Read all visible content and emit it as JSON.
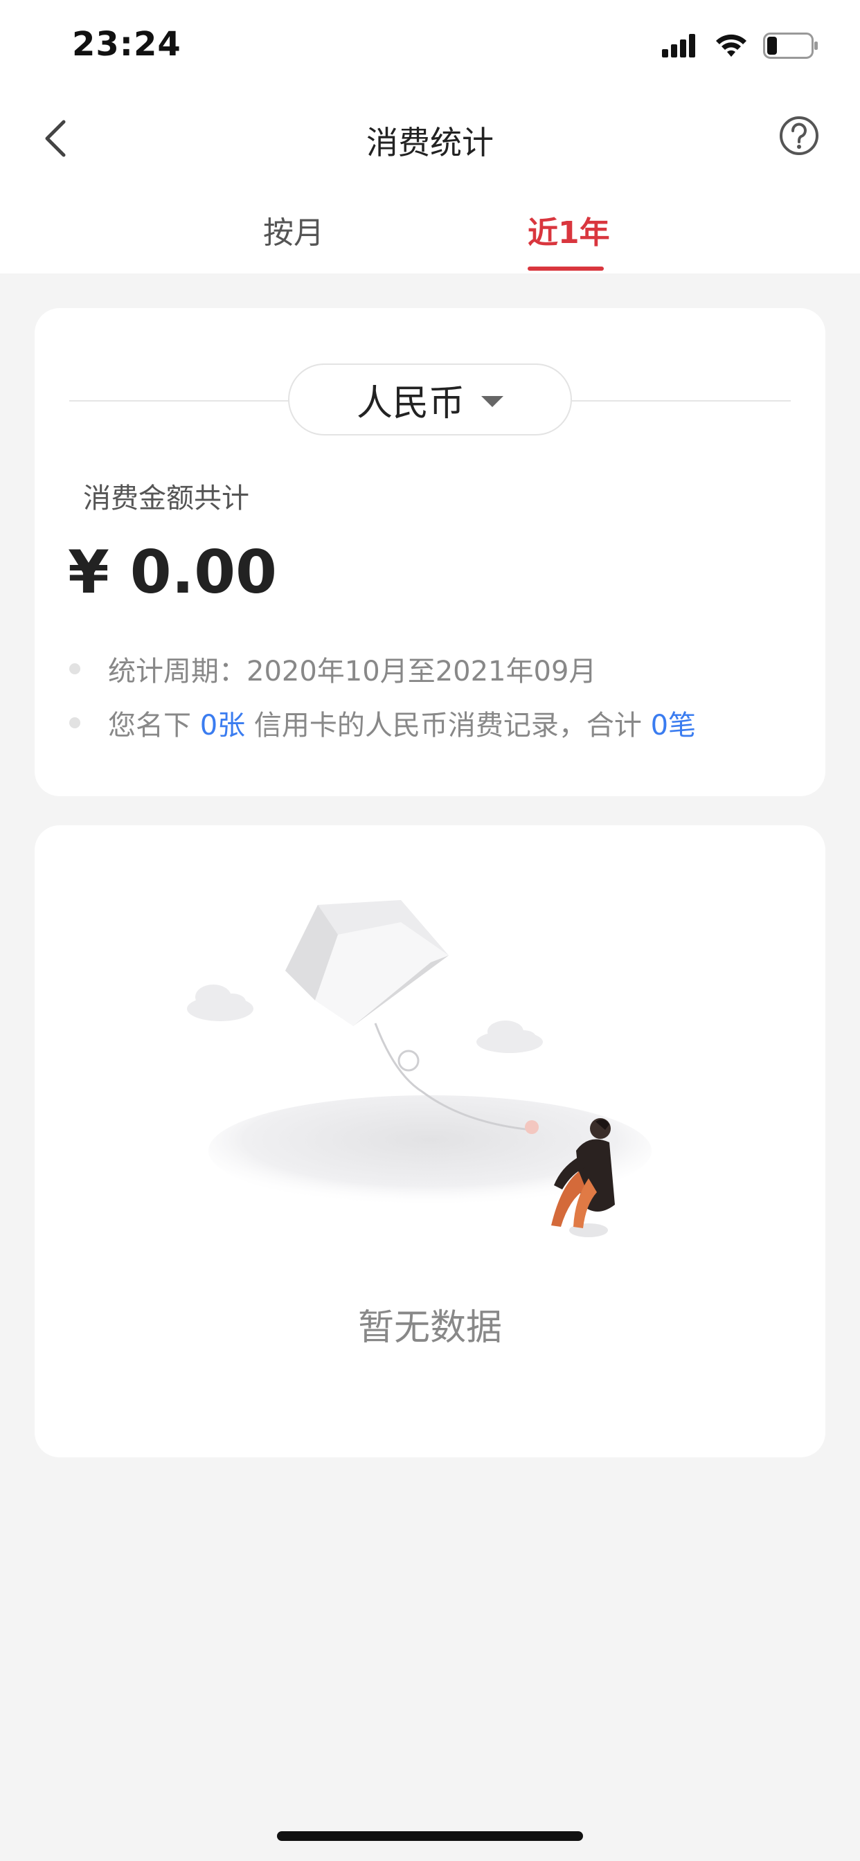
{
  "status_bar": {
    "time": "23:24"
  },
  "nav": {
    "title": "消费统计"
  },
  "tabs": [
    {
      "label": "按月",
      "active": false
    },
    {
      "label": "近1年",
      "active": true
    }
  ],
  "summary": {
    "currency": "人民币",
    "total_label": "消费金额共计",
    "total_amount": "¥ 0.00",
    "period_text": "统计周期：2020年10月至2021年09月",
    "record_prefix": "您名下 ",
    "card_count": "0张",
    "record_middle": " 信用卡的人民币消费记录，合计 ",
    "record_count": "0笔"
  },
  "empty_state": {
    "message": "暂无数据"
  },
  "colors": {
    "accent": "#d9363e",
    "link": "#3a7cf0",
    "background": "#f4f4f4"
  }
}
